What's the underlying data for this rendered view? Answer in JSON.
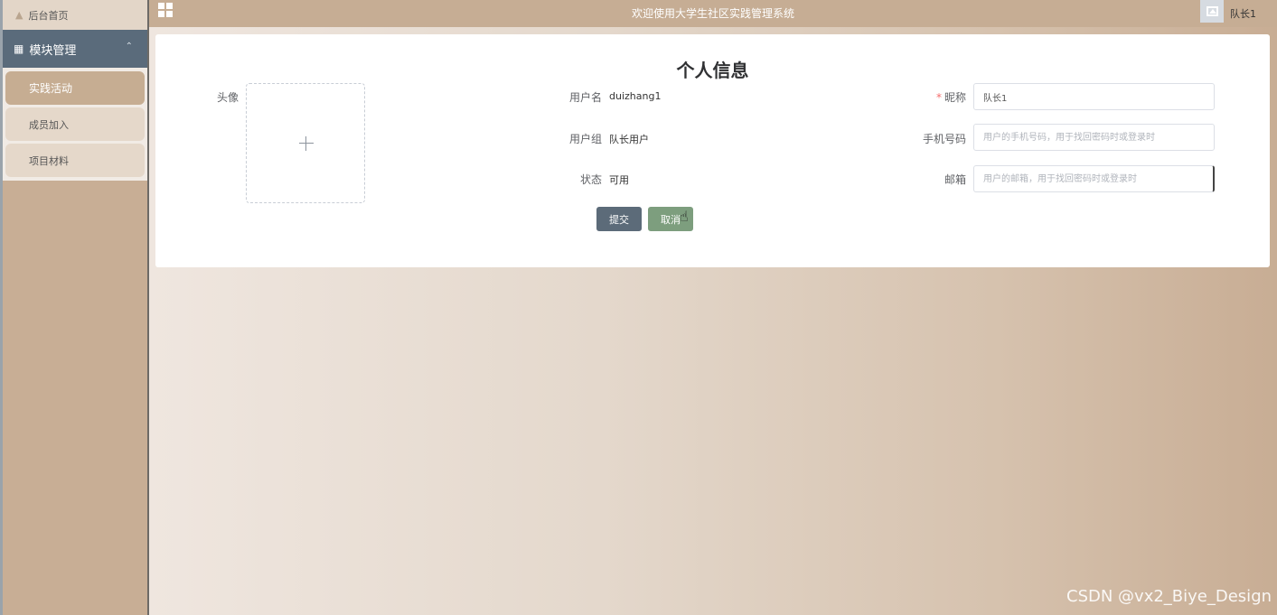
{
  "sidebar": {
    "home_label": "后台首页",
    "group_label": "模块管理",
    "items": [
      {
        "label": "实践活动",
        "active": true
      },
      {
        "label": "成员加入",
        "active": false
      },
      {
        "label": "项目材料",
        "active": false
      }
    ]
  },
  "header": {
    "title": "欢迎使用大学生社区实践管理系统",
    "username": "队长1"
  },
  "form": {
    "title": "个人信息",
    "avatar_label": "头像",
    "username_label": "用户名",
    "username_value": "duizhang1",
    "usergroup_label": "用户组",
    "usergroup_value": "队长用户",
    "status_label": "状态",
    "status_value": "可用",
    "nickname_label": "昵称",
    "nickname_required": "*",
    "nickname_value": "队长1",
    "phone_label": "手机号码",
    "phone_placeholder": "用户的手机号码，用于找回密码时或登录时",
    "email_label": "邮箱",
    "email_placeholder": "用户的邮箱，用于找回密码时或登录时",
    "submit_label": "提交",
    "cancel_label": "取消"
  },
  "watermark": "CSDN @vx2_Biye_Design",
  "colors": {
    "sidebar_bg": "#c8ae95",
    "group_bg": "#5a6b7b",
    "topbar_bg": "#c6ad94",
    "submit_bg": "#5c6b79",
    "cancel_bg": "#7d9e7e",
    "required": "#f56c6c"
  },
  "icons": {
    "home": "home-icon",
    "module": "grid-icon",
    "collapse": "chevron-up-icon",
    "menu": "grid-menu-icon",
    "avatar": "image-icon",
    "upload": "plus-icon"
  }
}
